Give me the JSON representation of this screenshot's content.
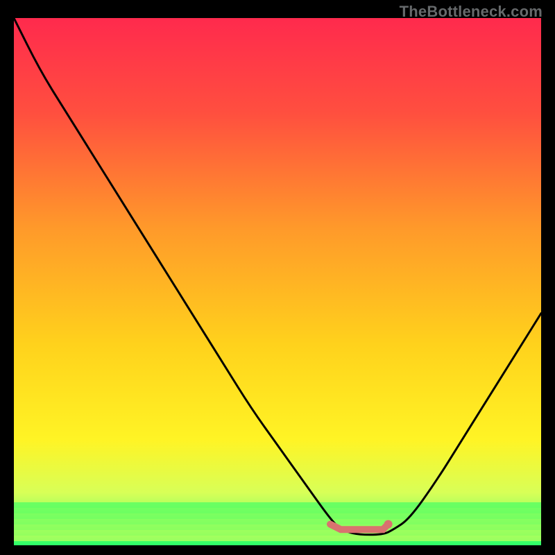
{
  "watermark": "TheBottleneck.com",
  "chart_data": {
    "type": "line",
    "title": "",
    "xlabel": "",
    "ylabel": "",
    "xlim": [
      0,
      100
    ],
    "ylim": [
      0,
      100
    ],
    "series": [
      {
        "name": "curve",
        "x": [
          0,
          5,
          10,
          15,
          20,
          25,
          30,
          35,
          40,
          45,
          50,
          55,
          60,
          62,
          65,
          70,
          72,
          75,
          80,
          85,
          90,
          95,
          100
        ],
        "values": [
          100,
          90,
          82,
          74,
          66,
          58,
          50,
          42,
          34,
          26,
          19,
          12,
          5,
          3,
          2,
          2,
          3,
          5,
          12,
          20,
          28,
          36,
          44
        ]
      },
      {
        "name": "marker-segment",
        "x": [
          60,
          62,
          65,
          68,
          70,
          71
        ],
        "values": [
          4,
          3,
          3,
          3,
          3,
          4
        ]
      }
    ],
    "gradient_stops": [
      {
        "pct": 0,
        "color": "#ff2a4d"
      },
      {
        "pct": 18,
        "color": "#ff4f3f"
      },
      {
        "pct": 40,
        "color": "#ff9a2a"
      },
      {
        "pct": 62,
        "color": "#ffd21c"
      },
      {
        "pct": 80,
        "color": "#fff425"
      },
      {
        "pct": 90,
        "color": "#d8ff57"
      },
      {
        "pct": 96,
        "color": "#7dff66"
      },
      {
        "pct": 100,
        "color": "#2cff68"
      }
    ],
    "marker_color": "#d9726f",
    "curve_color": "#000000"
  }
}
